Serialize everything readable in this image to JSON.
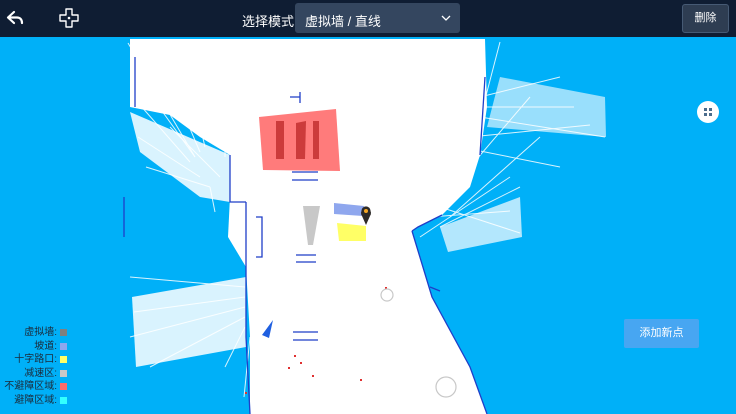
{
  "toolbar": {
    "back_icon": "back-arrow-icon",
    "add_icon": "crosshair-plus-icon",
    "mode_label": "选择模式",
    "mode_value": "虚拟墙 / 直线",
    "delete_label": "删除"
  },
  "map": {
    "grid_icon": "grid-dots-icon",
    "add_point_label": "添加新点",
    "robot_icon": "robot-arrow-icon",
    "marker_icon": "location-pin-icon"
  },
  "legend": [
    {
      "label": "虚拟墙:",
      "color": "#808080"
    },
    {
      "label": "坡道:",
      "color": "#8fa7ee"
    },
    {
      "label": "十字路口:",
      "color": "#ffff66"
    },
    {
      "label": "减速区:",
      "color": "#c8c8c8"
    },
    {
      "label": "不避障区域:",
      "color": "#ff6b6b"
    },
    {
      "label": "避障区域:",
      "color": "#33ffff"
    }
  ],
  "colors": {
    "topbar": "#0f1d33",
    "background": "#00b0f8",
    "map_free": "#ffffff",
    "no_avoid_zone": "#ff7b7b",
    "slope": "#8fa7ee",
    "crossroad": "#ffff66",
    "slow_zone": "#c8c8c8"
  }
}
